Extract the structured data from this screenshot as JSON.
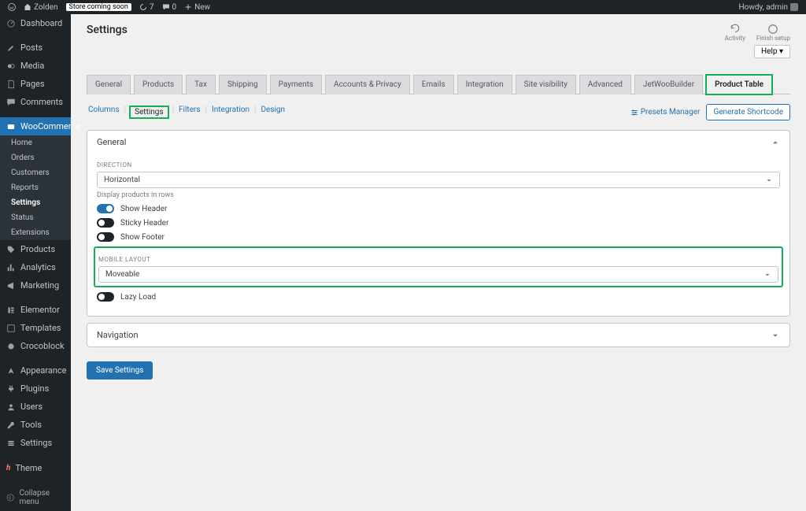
{
  "adminbar": {
    "site_name": "Zolden",
    "store_badge": "Store coming soon",
    "updates_count": "7",
    "comments_count": "0",
    "new_label": "New",
    "howdy": "Howdy, admin"
  },
  "sidebar": {
    "dashboard": "Dashboard",
    "posts": "Posts",
    "media": "Media",
    "pages": "Pages",
    "comments": "Comments",
    "woocommerce": "WooCommerce",
    "submenu": {
      "home": "Home",
      "orders": "Orders",
      "customers": "Customers",
      "reports": "Reports",
      "settings": "Settings",
      "status": "Status",
      "extensions": "Extensions"
    },
    "products": "Products",
    "analytics": "Analytics",
    "marketing": "Marketing",
    "elementor": "Elementor",
    "templates": "Templates",
    "crocoblock": "Crocoblock",
    "appearance": "Appearance",
    "plugins": "Plugins",
    "users": "Users",
    "tools": "Tools",
    "settings_menu": "Settings",
    "theme": "Theme",
    "collapse": "Collapse menu"
  },
  "page": {
    "title": "Settings",
    "activity": "Activity",
    "finish_setup": "Finish setup",
    "help": "Help"
  },
  "tabs": {
    "general": "General",
    "products": "Products",
    "tax": "Tax",
    "shipping": "Shipping",
    "payments": "Payments",
    "accounts": "Accounts & Privacy",
    "emails": "Emails",
    "integration": "Integration",
    "site_visibility": "Site visibility",
    "advanced": "Advanced",
    "jetwoo": "JetWooBuilder",
    "product_table": "Product Table"
  },
  "subtabs": {
    "columns": "Columns",
    "settings": "Settings",
    "filters": "Filters",
    "integration": "Integration",
    "design": "Design"
  },
  "actions": {
    "presets": "Presets Manager",
    "generate": "Generate Shortcode"
  },
  "general_section": {
    "title": "General",
    "direction_label": "DIRECTION",
    "direction_value": "Horizontal",
    "direction_caption": "Display products in rows",
    "show_header": "Show Header",
    "sticky_header": "Sticky Header",
    "show_footer": "Show Footer",
    "mobile_label": "MOBILE LAYOUT",
    "mobile_value": "Moveable",
    "lazy_load": "Lazy Load"
  },
  "navigation_section": {
    "title": "Navigation"
  },
  "save": "Save Settings"
}
